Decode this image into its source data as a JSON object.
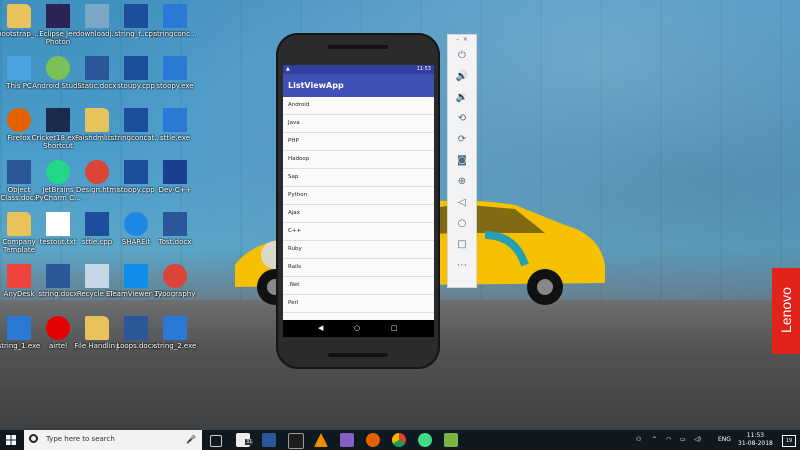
{
  "desktop": {
    "icons": [
      {
        "label": "bootstrap_...",
        "kind": "folder"
      },
      {
        "label": "Eclipse Jee Photon",
        "kind": "eclipse"
      },
      {
        "label": "downloadj...",
        "kind": "image"
      },
      {
        "label": "string_f..cpp",
        "kind": "cpp"
      },
      {
        "label": "stringconc...",
        "kind": "exe"
      },
      {
        "label": "This PC",
        "kind": "pc"
      },
      {
        "label": "Android Studio",
        "kind": "android"
      },
      {
        "label": "Static.docx",
        "kind": "word"
      },
      {
        "label": "stoupy.cpp",
        "kind": "cpp"
      },
      {
        "label": "stoopy.exe",
        "kind": "exe"
      },
      {
        "label": "Firefox",
        "kind": "firefox"
      },
      {
        "label": "Cricket18.exe - Shortcut",
        "kind": "cricket"
      },
      {
        "label": "Faishdmlib...",
        "kind": "folder"
      },
      {
        "label": "stringconcat...",
        "kind": "cpp"
      },
      {
        "label": "sttle.exe",
        "kind": "exe"
      },
      {
        "label": "Object Class.docx",
        "kind": "word"
      },
      {
        "label": "JetBrains PyCharm C...",
        "kind": "pycharm"
      },
      {
        "label": "Design.html",
        "kind": "chrome"
      },
      {
        "label": "stoopy.cpp",
        "kind": "cpp"
      },
      {
        "label": "Dev-C++",
        "kind": "devcpp"
      },
      {
        "label": "Company Template",
        "kind": "folder"
      },
      {
        "label": "testout.txt",
        "kind": "text"
      },
      {
        "label": "sttle.cpp",
        "kind": "cpp"
      },
      {
        "label": "SHAREit",
        "kind": "shareit"
      },
      {
        "label": "Tost.docx",
        "kind": "word"
      },
      {
        "label": "AnyDesk",
        "kind": "anydesk"
      },
      {
        "label": "string.docx",
        "kind": "word"
      },
      {
        "label": "Recycle Bin",
        "kind": "bin"
      },
      {
        "label": "TeamViewer 13",
        "kind": "teamviewer"
      },
      {
        "label": "Typography",
        "kind": "chrome"
      },
      {
        "label": "string_1.exe",
        "kind": "exe"
      },
      {
        "label": "airtel",
        "kind": "airtel"
      },
      {
        "label": "File Handling",
        "kind": "folder"
      },
      {
        "label": "Loops.docx",
        "kind": "word"
      },
      {
        "label": "string_2.exe",
        "kind": "exe"
      }
    ]
  },
  "emulator": {
    "status_time": "11:53",
    "app_title": "ListViewApp",
    "list_items": [
      "Android",
      "Java",
      "PHP",
      "Hadoop",
      "Sap",
      "Python",
      "Ajax",
      "C++",
      "Ruby",
      "Rails",
      ".Net",
      "Perl"
    ],
    "toolbar": [
      "power-icon",
      "volume-up-icon",
      "volume-down-icon",
      "rotate-left-icon",
      "rotate-right-icon",
      "camera-icon",
      "zoom-icon",
      "back-icon",
      "home-icon",
      "overview-icon",
      "more-icon"
    ]
  },
  "branding": {
    "lenovo": "Lenovo"
  },
  "taskbar": {
    "search_placeholder": "Type here to search",
    "language": "ENG",
    "time": "11:53",
    "date": "31-08-2018",
    "notification_count": "19",
    "badge_count": "31"
  },
  "colors": {
    "app_primary": "#3f51b5",
    "app_primary_dark": "#303f9f",
    "lenovo_red": "#e2231a"
  }
}
